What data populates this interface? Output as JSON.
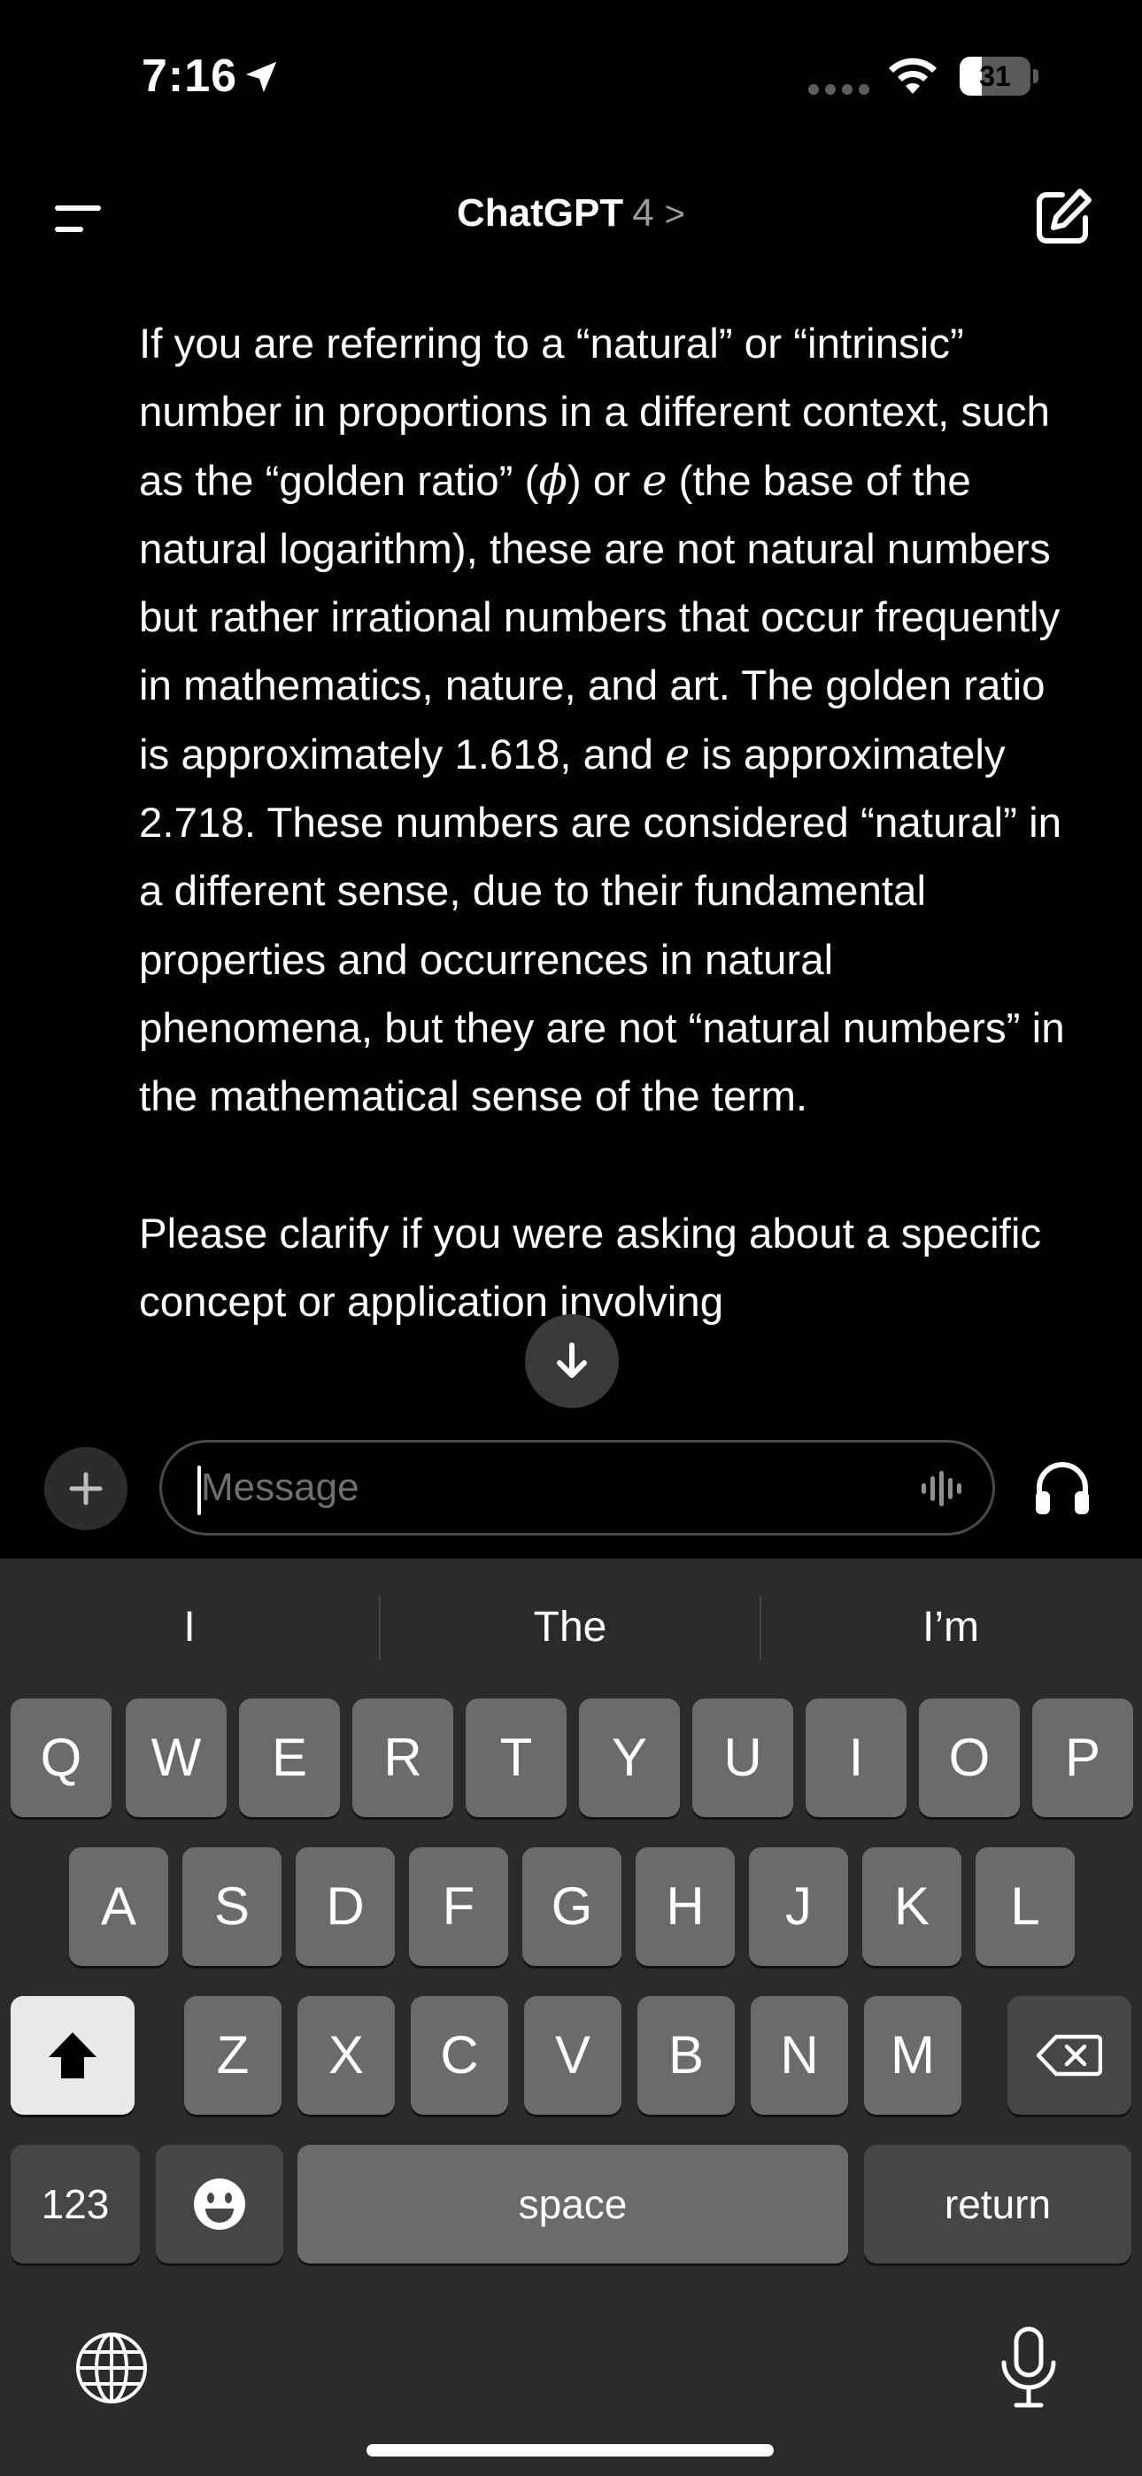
{
  "status_bar": {
    "time": "7:16",
    "battery_level": "31",
    "battery_fraction": 0.31,
    "icons": [
      "location-arrow-icon",
      "cellular-dots-icon",
      "wifi-icon",
      "battery-icon"
    ]
  },
  "nav": {
    "title": "ChatGPT",
    "model": "4",
    "chevron": ">",
    "icons": [
      "menu-icon",
      "new-chat-edit-icon"
    ]
  },
  "message": {
    "paragraph_1_parts": [
      "If you are referring to a “natural” or “intrinsic” number in proportions in a different context, such as the “golden ratio” (",
      "ϕ",
      ") or ",
      "e",
      " (the base of the natural logarithm), these are not natural numbers but rather irrational numbers that occur frequently in mathematics, nature, and art. The golden ratio is approximately 1.618, and ",
      "e",
      " is approximately 2.718. These numbers are considered “natural” in a different sense, due to their fundamental properties and occurrences in natural phenomena, but they are not “natural numbers” in the mathematical sense of the term."
    ],
    "paragraph_2": "Please clarify if you were asking about a specific concept or application involving"
  },
  "composer": {
    "placeholder": "Message",
    "icons": [
      "plus-icon",
      "voice-waveform-icon",
      "headphones-icon",
      "scroll-down-arrow-icon"
    ]
  },
  "keyboard": {
    "suggestions": [
      "I",
      "The",
      "I’m"
    ],
    "row1": [
      "Q",
      "W",
      "E",
      "R",
      "T",
      "Y",
      "U",
      "I",
      "O",
      "P"
    ],
    "row2": [
      "A",
      "S",
      "D",
      "F",
      "G",
      "H",
      "J",
      "K",
      "L"
    ],
    "row3": [
      "Z",
      "X",
      "C",
      "V",
      "B",
      "N",
      "M"
    ],
    "numbers_label": "123",
    "space_label": "space",
    "return_label": "return",
    "icons": [
      "shift-icon",
      "delete-icon",
      "emoji-icon",
      "globe-icon",
      "microphone-icon"
    ]
  }
}
